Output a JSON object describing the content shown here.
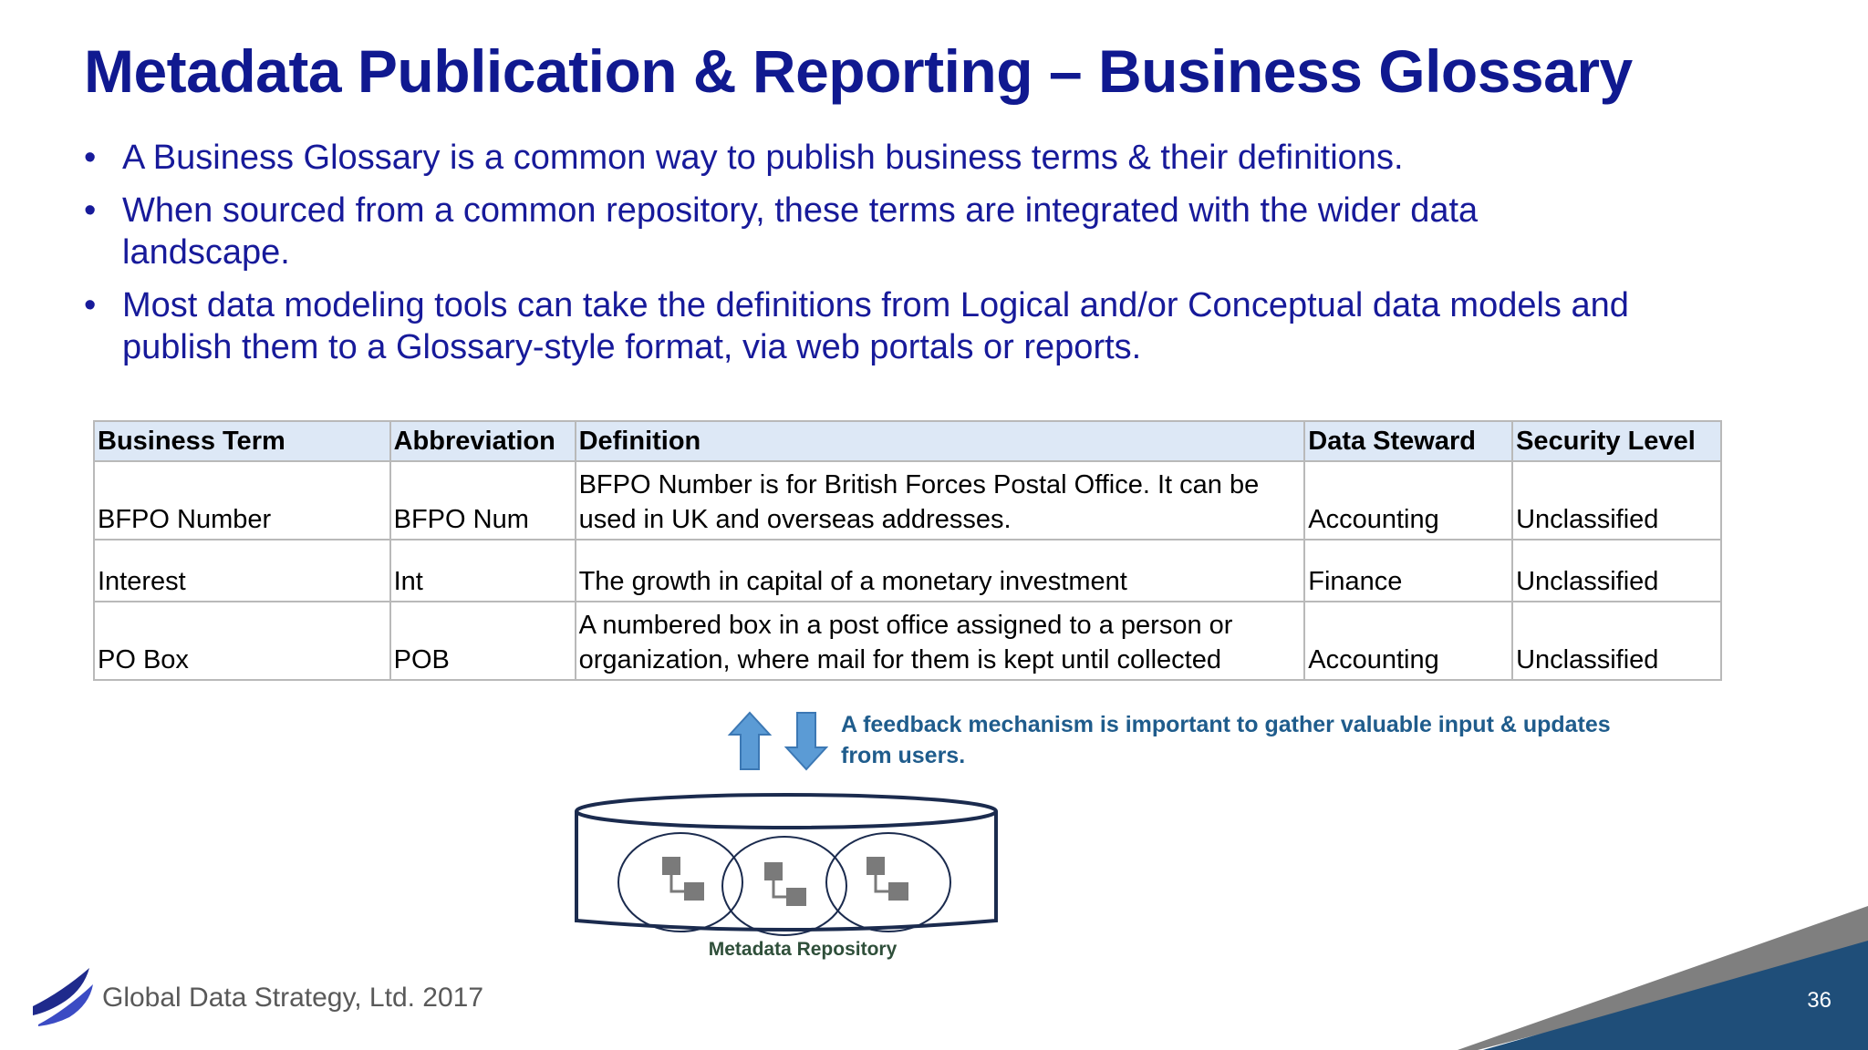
{
  "slide": {
    "title": "Metadata Publication & Reporting – Business Glossary",
    "bullet_symbol": "•",
    "bullets": [
      "A Business Glossary is a common way to publish business terms & their definitions.",
      "When sourced from a common repository, these terms are integrated with the wider data landscape.",
      "Most data modeling tools can take the definitions from Logical and/or Conceptual data models and publish them to a Glossary-style format, via web portals or reports."
    ]
  },
  "table": {
    "headers": [
      "Business Term",
      "Abbreviation",
      "Definition",
      "Data Steward",
      "Security Level"
    ],
    "rows": [
      [
        "BFPO Number",
        "BFPO Num",
        "BFPO Number is for British Forces Postal Office. It can be used in UK and overseas addresses.",
        "Accounting",
        "Unclassified"
      ],
      [
        "Interest",
        "Int",
        "The growth in capital of a monetary investment",
        "Finance",
        "Unclassified"
      ],
      [
        "PO Box",
        "POB",
        "A numbered box in a post office assigned to a person or organization, where mail for them is kept until collected",
        "Accounting",
        "Unclassified"
      ]
    ]
  },
  "feedback_note": "A feedback mechanism is important to gather valuable input & updates from users.",
  "repository_label": "Metadata Repository",
  "footer": {
    "company": "Global Data Strategy, Ltd. 2017",
    "page_number": "36"
  },
  "icons": [
    "up-arrow-icon",
    "down-arrow-icon",
    "database-icon",
    "model-diagram-icon",
    "logo-icon"
  ],
  "colors": {
    "title": "#101990",
    "bullet_text": "#171a9a",
    "table_header_bg": "#dde8f6",
    "feedback_text": "#1f5c8c",
    "arrow_fill": "#5b9bd5",
    "corner_gray": "#7f7f7f",
    "corner_navy": "#1f4e79"
  }
}
